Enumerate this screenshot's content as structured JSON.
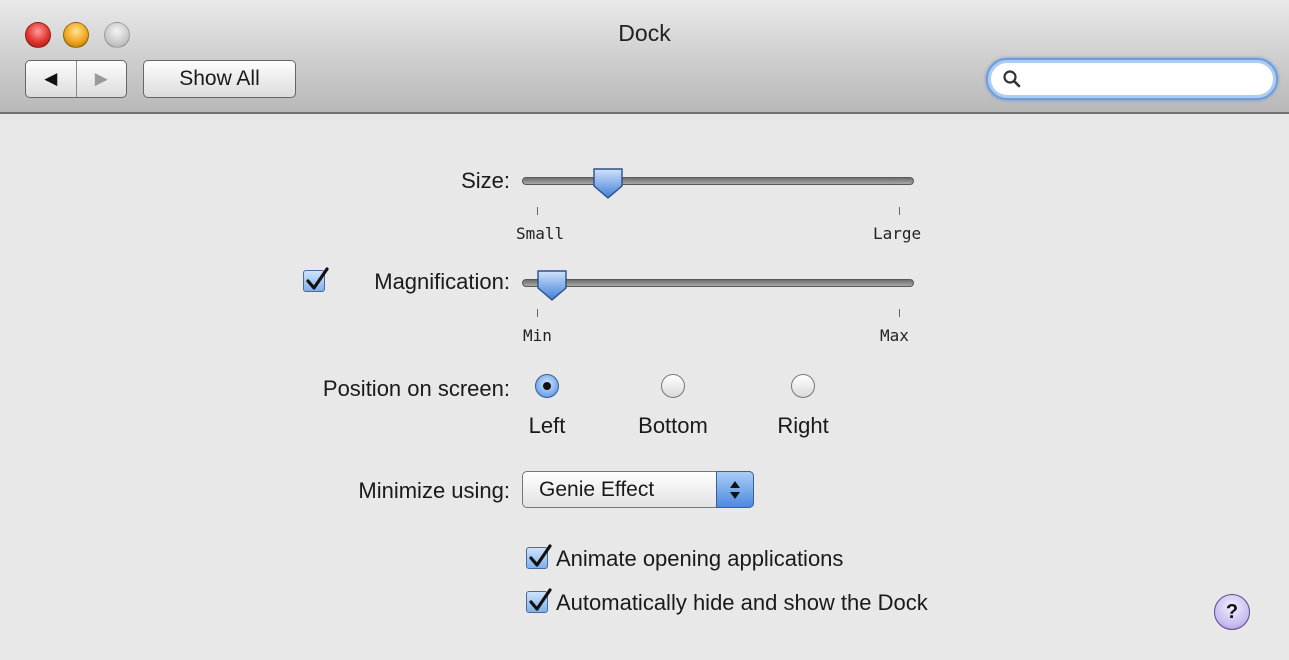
{
  "window": {
    "title": "Dock",
    "show_all_label": "Show All",
    "back_glyph": "◀",
    "forward_glyph": "▶",
    "search": {
      "value": "",
      "placeholder": "",
      "icon": "magnifier-icon"
    }
  },
  "size": {
    "label": "Size:",
    "min_label": "Small",
    "max_label": "Large",
    "value_fraction": 0.2
  },
  "magnification": {
    "label": "Magnification:",
    "checked": true,
    "min_label": "Min",
    "max_label": "Max",
    "value_fraction": 0.05
  },
  "position": {
    "label": "Position on screen:",
    "options": [
      {
        "label": "Left",
        "selected": true
      },
      {
        "label": "Bottom",
        "selected": false
      },
      {
        "label": "Right",
        "selected": false
      }
    ]
  },
  "minimize": {
    "label": "Minimize using:",
    "value": "Genie Effect"
  },
  "options": {
    "animate_label": "Animate opening applications",
    "animate_checked": true,
    "autohide_label": "Automatically hide and show the Dock",
    "autohide_checked": true
  },
  "help_glyph": "?",
  "colors": {
    "accent": "#5b93e0",
    "window_bg": "#e8e8e8"
  }
}
